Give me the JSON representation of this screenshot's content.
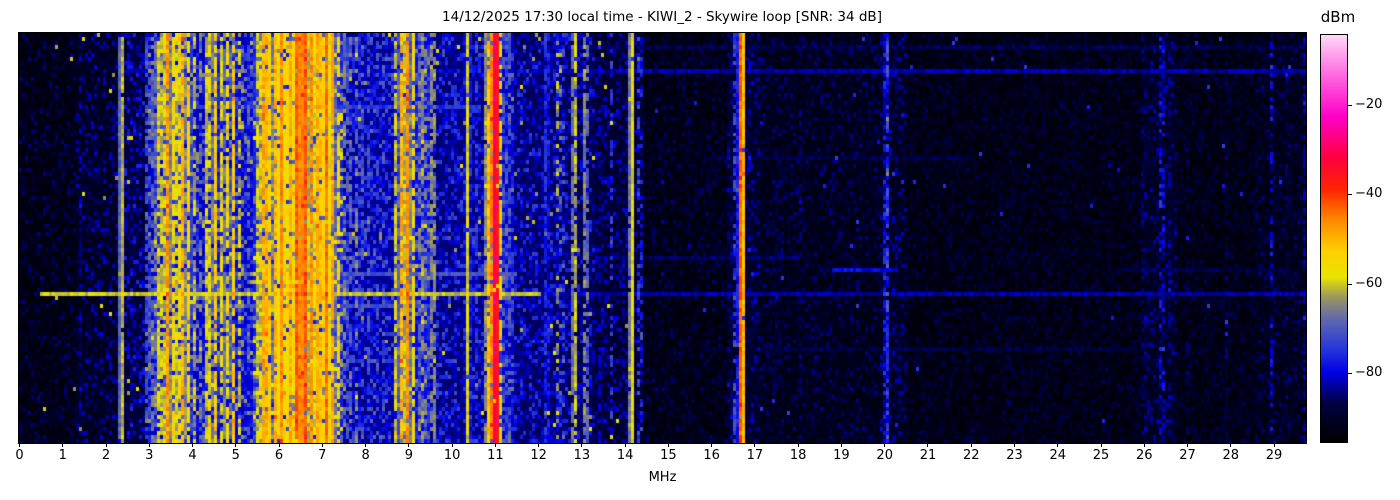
{
  "figure": {
    "title": "14/12/2025 17:30 local time - KIWI_2 - Skywire loop [SNR: 34 dB]",
    "background": "#ffffff"
  },
  "chart_data": {
    "type": "heatmap",
    "subtype": "radio-spectrogram-waterfall",
    "title": "14/12/2025 17:30 local time - KIWI_2 - Skywire loop [SNR: 34 dB]",
    "station": "KIWI_2",
    "antenna": "Skywire loop",
    "snr_db": 34,
    "datetime_local": "14/12/2025 17:30",
    "xlabel": "MHz",
    "x_axis": {
      "unit": "MHz",
      "min": 0,
      "max": 29.75,
      "ticks": [
        0,
        1,
        2,
        3,
        4,
        5,
        6,
        7,
        8,
        9,
        10,
        11,
        12,
        13,
        14,
        15,
        16,
        17,
        18,
        19,
        20,
        21,
        22,
        23,
        24,
        25,
        26,
        27,
        28,
        29
      ]
    },
    "colorbar": {
      "label": "dBm",
      "tick_labels": [
        "−20",
        "−40",
        "−60",
        "−80"
      ],
      "tick_values": [
        -20,
        -40,
        -60,
        -80
      ],
      "vmax": -4.3,
      "vmin": -95.5
    },
    "colormap_stops": [
      [
        0.0,
        "#000000"
      ],
      [
        0.095,
        "#000042"
      ],
      [
        0.17,
        "#0000e6"
      ],
      [
        0.225,
        "#2434dd"
      ],
      [
        0.3,
        "#5f68b0"
      ],
      [
        0.355,
        "#9b9660"
      ],
      [
        0.405,
        "#e8e400"
      ],
      [
        0.47,
        "#ffd000"
      ],
      [
        0.55,
        "#ff8400"
      ],
      [
        0.62,
        "#ff2500"
      ],
      [
        0.7,
        "#ff0040"
      ],
      [
        0.8,
        "#ff00c8"
      ],
      [
        0.9,
        "#ff66e0"
      ],
      [
        1.0,
        "#ffd8f6"
      ]
    ],
    "plot_bg": "#000000",
    "grid": {
      "cols": 429,
      "rows": 103
    },
    "seed": 7,
    "noise_floor_bands": [
      [
        0,
        1.35,
        -94,
        10
      ],
      [
        1.35,
        2.3,
        -92,
        12
      ],
      [
        2.3,
        2.95,
        -89,
        13
      ],
      [
        2.95,
        5.4,
        -82,
        20
      ],
      [
        5.4,
        7.5,
        -78,
        22
      ],
      [
        7.5,
        8.65,
        -84,
        16
      ],
      [
        8.65,
        9.5,
        -80,
        18
      ],
      [
        9.5,
        10.8,
        -85,
        14
      ],
      [
        10.8,
        11.45,
        -82,
        16
      ],
      [
        11.45,
        12.7,
        -86,
        13
      ],
      [
        12.7,
        13.3,
        -87,
        12
      ],
      [
        13.3,
        14.45,
        -90,
        11
      ],
      [
        14.45,
        16.4,
        -94,
        9
      ],
      [
        16.4,
        17.1,
        -91,
        10
      ],
      [
        17.1,
        19.9,
        -93,
        9
      ],
      [
        19.9,
        20.5,
        -92,
        11
      ],
      [
        20.5,
        26.0,
        -94,
        8
      ],
      [
        26.0,
        26.8,
        -92,
        10
      ],
      [
        26.8,
        28.6,
        -94,
        8
      ],
      [
        28.6,
        29.35,
        -93,
        9
      ],
      [
        29.35,
        29.75,
        -93,
        9
      ]
    ],
    "signals": [
      [
        1.42,
        0.02,
        -83,
        5,
        0.45
      ],
      [
        2.37,
        0.025,
        -57,
        5,
        0.97
      ],
      [
        2.62,
        0.015,
        -82,
        6,
        0.3
      ],
      [
        2.98,
        0.02,
        -63,
        8,
        0.55
      ],
      [
        3.12,
        0.02,
        -59,
        8,
        0.65
      ],
      [
        3.22,
        0.025,
        -55,
        8,
        0.75
      ],
      [
        3.33,
        0.025,
        -51,
        8,
        0.8
      ],
      [
        3.44,
        0.03,
        -44,
        7,
        0.9
      ],
      [
        3.56,
        0.028,
        -51,
        8,
        0.8
      ],
      [
        3.68,
        0.028,
        -49,
        8,
        0.8
      ],
      [
        3.79,
        0.03,
        -46,
        7,
        0.85
      ],
      [
        3.92,
        0.028,
        -51,
        8,
        0.8
      ],
      [
        4.05,
        0.025,
        -57,
        9,
        0.7
      ],
      [
        4.2,
        0.02,
        -63,
        9,
        0.5
      ],
      [
        4.37,
        0.025,
        -50,
        8,
        0.8
      ],
      [
        4.53,
        0.025,
        -48,
        8,
        0.85
      ],
      [
        4.68,
        0.025,
        -54,
        8,
        0.75
      ],
      [
        4.8,
        0.025,
        -52,
        8,
        0.75
      ],
      [
        4.95,
        0.025,
        -49,
        8,
        0.8
      ],
      [
        5.1,
        0.02,
        -57,
        9,
        0.6
      ],
      [
        5.32,
        0.018,
        -65,
        9,
        0.45
      ],
      [
        5.55,
        0.025,
        -51,
        8,
        0.8
      ],
      [
        5.65,
        0.028,
        -46,
        7,
        0.85
      ],
      [
        5.75,
        0.03,
        -43,
        6,
        0.9
      ],
      [
        5.92,
        0.028,
        -47,
        7,
        0.85
      ],
      [
        6.05,
        0.03,
        -42,
        6,
        0.92
      ],
      [
        6.17,
        0.028,
        -46,
        7,
        0.85
      ],
      [
        6.3,
        0.028,
        -44,
        6,
        0.9
      ],
      [
        6.42,
        0.03,
        -40,
        5,
        0.95
      ],
      [
        6.52,
        0.03,
        -38,
        5,
        0.97
      ],
      [
        6.62,
        0.03,
        -40,
        5,
        0.95
      ],
      [
        6.75,
        0.028,
        -43,
        6,
        0.9
      ],
      [
        6.88,
        0.028,
        -45,
        6,
        0.9
      ],
      [
        7.0,
        0.028,
        -44,
        6,
        0.9
      ],
      [
        7.12,
        0.028,
        -41,
        5,
        0.95
      ],
      [
        7.25,
        0.025,
        -46,
        6,
        0.85
      ],
      [
        7.38,
        0.022,
        -52,
        8,
        0.75
      ],
      [
        7.55,
        0.018,
        -59,
        9,
        0.55
      ],
      [
        7.68,
        0.015,
        -64,
        9,
        0.45
      ],
      [
        7.82,
        0.015,
        -61,
        9,
        0.5
      ],
      [
        7.95,
        0.015,
        -66,
        9,
        0.4
      ],
      [
        8.1,
        0.015,
        -67,
        9,
        0.4
      ],
      [
        8.28,
        0.015,
        -69,
        9,
        0.35
      ],
      [
        8.45,
        0.015,
        -65,
        9,
        0.4
      ],
      [
        8.72,
        0.022,
        -54,
        8,
        0.7
      ],
      [
        8.85,
        0.025,
        -46,
        7,
        0.85
      ],
      [
        8.97,
        0.025,
        -43,
        6,
        0.9
      ],
      [
        9.1,
        0.022,
        -51,
        8,
        0.8
      ],
      [
        9.3,
        0.018,
        -57,
        9,
        0.6
      ],
      [
        9.42,
        0.015,
        -61,
        9,
        0.5
      ],
      [
        9.57,
        0.015,
        -56,
        8,
        0.75
      ],
      [
        9.9,
        0.012,
        -73,
        9,
        0.35
      ],
      [
        10.1,
        0.012,
        -75,
        9,
        0.3
      ],
      [
        10.37,
        0.012,
        -56,
        6,
        0.95
      ],
      [
        10.6,
        0.012,
        -67,
        9,
        0.35
      ],
      [
        10.84,
        0.02,
        -47,
        7,
        0.85
      ],
      [
        10.93,
        0.02,
        -42,
        6,
        0.9
      ],
      [
        11.02,
        0.022,
        -26,
        4,
        0.97
      ],
      [
        11.12,
        0.02,
        -53,
        8,
        0.75
      ],
      [
        11.23,
        0.015,
        -63,
        9,
        0.5
      ],
      [
        11.33,
        0.015,
        -67,
        9,
        0.45
      ],
      [
        11.6,
        0.012,
        -77,
        9,
        0.3
      ],
      [
        12.2,
        0.012,
        -69,
        7,
        0.75
      ],
      [
        12.45,
        0.015,
        -59,
        10,
        0.35
      ],
      [
        12.55,
        0.015,
        -61,
        10,
        0.3
      ],
      [
        12.84,
        0.018,
        -55,
        7,
        0.8
      ],
      [
        13.1,
        0.015,
        -58,
        8,
        0.6
      ],
      [
        13.45,
        0.012,
        -75,
        8,
        0.35
      ],
      [
        13.7,
        0.012,
        -71,
        8,
        0.4
      ],
      [
        14.16,
        0.018,
        -54,
        5,
        0.95
      ],
      [
        14.35,
        0.012,
        -67,
        8,
        0.4
      ],
      [
        14.85,
        0.01,
        -83,
        6,
        0.35
      ],
      [
        15.5,
        0.01,
        -86,
        6,
        0.25
      ],
      [
        16.44,
        0.012,
        -80,
        6,
        0.5
      ],
      [
        16.56,
        0.012,
        -68,
        8,
        0.6
      ],
      [
        16.7,
        0.025,
        -38,
        6,
        0.98
      ],
      [
        17.5,
        0.01,
        -85,
        6,
        0.3
      ],
      [
        18.05,
        0.01,
        -82,
        6,
        0.35
      ],
      [
        19.2,
        0.01,
        -85,
        6,
        0.25
      ],
      [
        19.7,
        0.01,
        -83,
        6,
        0.35
      ],
      [
        20.05,
        0.015,
        -66,
        14,
        0.9
      ],
      [
        20.6,
        0.01,
        -85,
        6,
        0.25
      ],
      [
        21.3,
        0.01,
        -87,
        6,
        0.2
      ],
      [
        23.2,
        0.01,
        -88,
        6,
        0.2
      ],
      [
        25.2,
        0.01,
        -87,
        6,
        0.2
      ],
      [
        26.0,
        0.014,
        -79,
        7,
        0.55
      ],
      [
        26.42,
        0.016,
        -71,
        10,
        0.6
      ],
      [
        26.6,
        0.012,
        -81,
        7,
        0.4
      ],
      [
        27.0,
        0.01,
        -84,
        6,
        0.3
      ],
      [
        27.9,
        0.01,
        -83,
        6,
        0.35
      ],
      [
        28.97,
        0.015,
        -75,
        10,
        0.55
      ],
      [
        29.3,
        0.01,
        -85,
        6,
        0.3
      ],
      [
        29.7,
        0.02,
        -80,
        6,
        0.6
      ]
    ],
    "time_events": [
      [
        0.032,
        9.5,
        29.75,
        -87,
        0
      ],
      [
        0.088,
        2.4,
        29.75,
        -84,
        1
      ],
      [
        0.175,
        2.95,
        10.6,
        -77,
        1
      ],
      [
        0.3,
        15.8,
        22.0,
        -88,
        0
      ],
      [
        0.4,
        9.8,
        14.5,
        -86,
        0
      ],
      [
        0.54,
        9.0,
        18.0,
        -86,
        0
      ],
      [
        0.568,
        18.8,
        20.3,
        -81,
        1
      ],
      [
        0.568,
        25.4,
        29.4,
        -88,
        0
      ],
      [
        0.585,
        4.3,
        11.5,
        -73,
        1
      ],
      [
        0.628,
        0.55,
        12.1,
        -64,
        3
      ],
      [
        0.628,
        12.1,
        29.75,
        -84,
        1
      ],
      [
        0.662,
        3.9,
        9.3,
        -74,
        1
      ],
      [
        0.705,
        4.3,
        8.3,
        -79,
        0
      ],
      [
        0.77,
        15.8,
        26.0,
        -88,
        0
      ]
    ]
  }
}
